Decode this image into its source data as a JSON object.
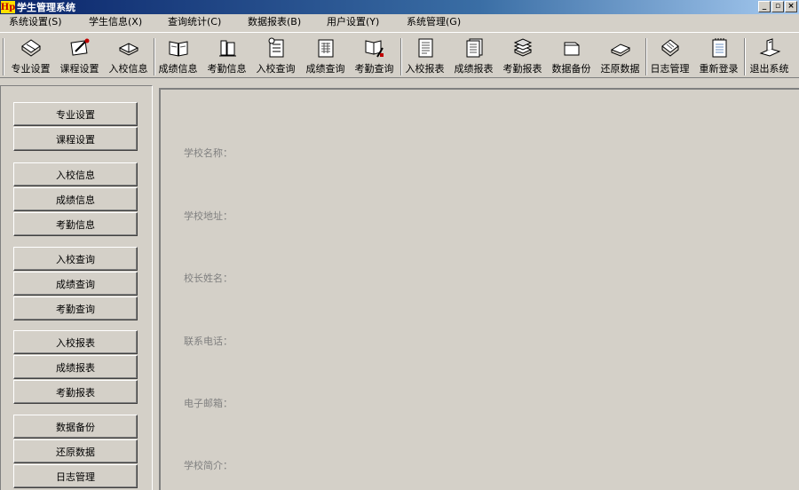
{
  "window": {
    "logo_text": "Hp",
    "title": "学生管理系统",
    "controls": [
      "_",
      "▫",
      "×"
    ]
  },
  "menu": [
    "系统设置(S)",
    "学生信息(X)",
    "查询统计(C)",
    "数据报表(B)",
    "用户设置(Y)",
    "系统管理(G)"
  ],
  "toolbar": [
    {
      "label": "专业设置",
      "icon": "pencil-icon"
    },
    {
      "label": "课程设置",
      "icon": "edit-paper-icon"
    },
    {
      "label": "入校信息",
      "icon": "open-book-icon"
    },
    {
      "label": "成绩信息",
      "icon": "book-icon"
    },
    {
      "label": "考勤信息",
      "icon": "book-stand-icon"
    },
    {
      "label": "入校查询",
      "icon": "document-query-icon"
    },
    {
      "label": "成绩查询",
      "icon": "document-grid-icon"
    },
    {
      "label": "考勤查询",
      "icon": "book-pen-icon"
    },
    {
      "label": "入校报表",
      "icon": "report-icon"
    },
    {
      "label": "成绩报表",
      "icon": "report-stack-icon"
    },
    {
      "label": "考勤报表",
      "icon": "books-stack-icon"
    },
    {
      "label": "数据备份",
      "icon": "folder-icon"
    },
    {
      "label": "还原数据",
      "icon": "disk-icon"
    },
    {
      "label": "日志管理",
      "icon": "notebook-icon"
    },
    {
      "label": "重新登录",
      "icon": "notepad-icon"
    },
    {
      "label": "退出系统",
      "icon": "exit-icon"
    }
  ],
  "sidebar": [
    "专业设置",
    "课程设置",
    "入校信息",
    "成绩信息",
    "考勤信息",
    "入校查询",
    "成绩查询",
    "考勤查询",
    "入校报表",
    "成绩报表",
    "考勤报表",
    "数据备份",
    "还原数据",
    "日志管理"
  ],
  "fields": [
    "学校名称：",
    "学校地址：",
    "校长姓名：",
    "联系电话：",
    "电子邮箱：",
    "学校简介："
  ]
}
